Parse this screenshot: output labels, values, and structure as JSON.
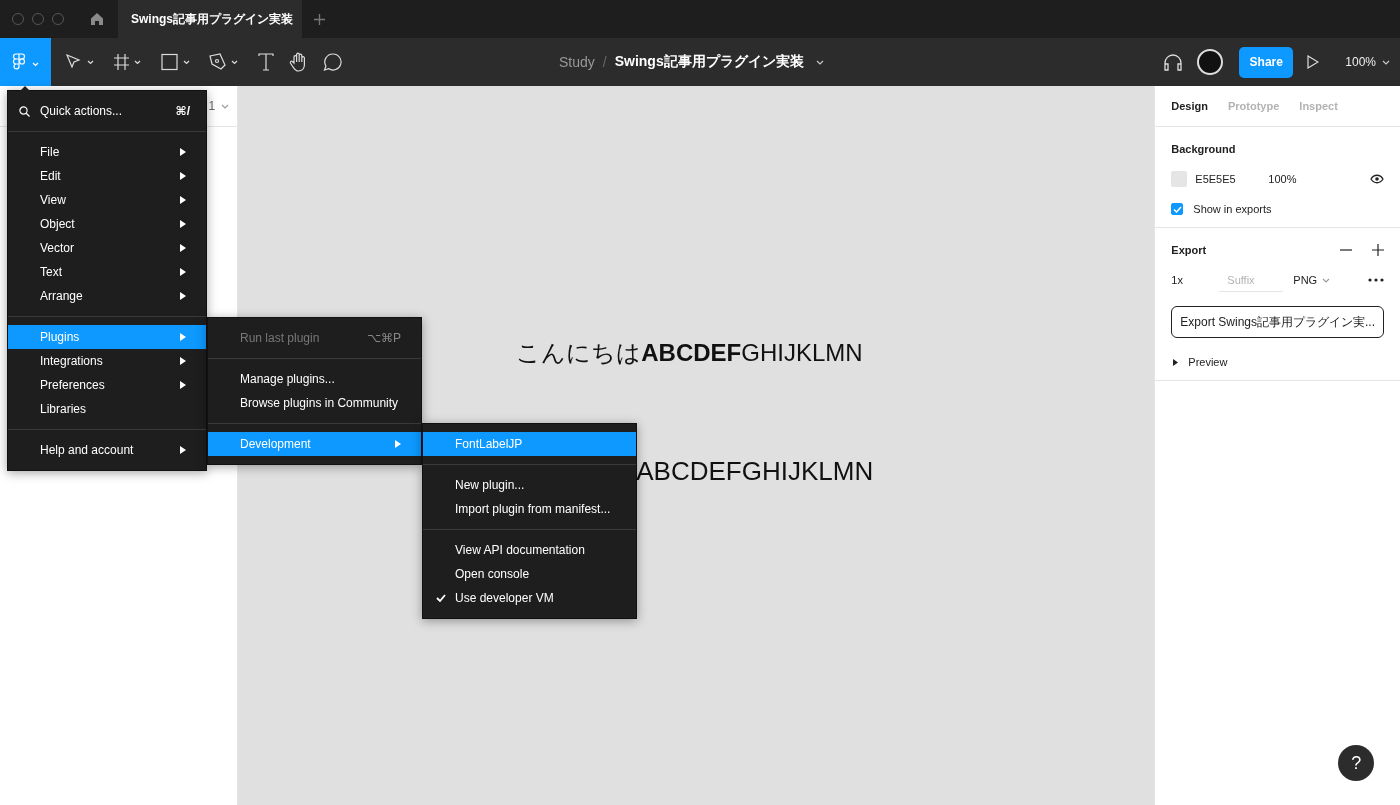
{
  "tab_bar": {
    "tabs": [
      {
        "title": "Swings記事用プラグイン実装",
        "selected": true
      }
    ]
  },
  "toolbar": {
    "breadcrumb": {
      "project": "Study",
      "separator": "/",
      "file": "Swings記事用プラグイン実装"
    },
    "share": "Share",
    "zoom": "100%"
  },
  "left_panel": {
    "page_selector": "1"
  },
  "canvas": {
    "texts": [
      "こんにちは**ABCDEF**GHIJKLMN",
      "ABCDEFGHIJKLMN"
    ]
  },
  "main_menu": {
    "search": {
      "label": "Quick actions...",
      "shortcut": "⌘/"
    },
    "items": [
      {
        "kind": "item",
        "label": "File",
        "submenu": true,
        "selected": false
      },
      {
        "kind": "item",
        "label": "Edit",
        "submenu": true,
        "selected": false
      },
      {
        "kind": "item",
        "label": "View",
        "submenu": true,
        "selected": false
      },
      {
        "kind": "item",
        "label": "Object",
        "submenu": true,
        "selected": false
      },
      {
        "kind": "item",
        "label": "Vector",
        "submenu": true,
        "selected": false
      },
      {
        "kind": "item",
        "label": "Text",
        "submenu": true,
        "selected": false
      },
      {
        "kind": "item",
        "label": "Arrange",
        "submenu": true,
        "selected": false
      },
      {
        "kind": "separator"
      },
      {
        "kind": "item",
        "label": "Plugins",
        "submenu": true,
        "selected": true
      },
      {
        "kind": "item",
        "label": "Integrations",
        "submenu": true,
        "selected": false
      },
      {
        "kind": "item",
        "label": "Preferences",
        "submenu": true,
        "selected": false
      },
      {
        "kind": "item",
        "label": "Libraries",
        "submenu": false,
        "selected": false
      },
      {
        "kind": "separator"
      },
      {
        "kind": "item",
        "label": "Help and account",
        "submenu": true,
        "selected": false
      }
    ]
  },
  "plugins_menu": {
    "items": [
      {
        "kind": "item",
        "label": "Run last plugin",
        "shortcut": "⌥⌘P",
        "disabled": true,
        "submenu": false,
        "selected": false
      },
      {
        "kind": "separator"
      },
      {
        "kind": "item",
        "label": "Manage plugins...",
        "disabled": false,
        "submenu": false,
        "selected": false
      },
      {
        "kind": "item",
        "label": "Browse plugins in Community",
        "disabled": false,
        "submenu": false,
        "selected": false
      },
      {
        "kind": "separator"
      },
      {
        "kind": "item",
        "label": "Development",
        "disabled": false,
        "submenu": true,
        "selected": true
      }
    ]
  },
  "development_menu": {
    "items": [
      {
        "kind": "item",
        "label": "FontLabelJP",
        "checked": false,
        "selected": true
      },
      {
        "kind": "separator"
      },
      {
        "kind": "item",
        "label": "New plugin...",
        "checked": false,
        "selected": false
      },
      {
        "kind": "item",
        "label": "Import plugin from manifest...",
        "checked": false,
        "selected": false
      },
      {
        "kind": "separator"
      },
      {
        "kind": "item",
        "label": "View API documentation",
        "checked": false,
        "selected": false
      },
      {
        "kind": "item",
        "label": "Open console",
        "checked": false,
        "selected": false
      },
      {
        "kind": "item",
        "label": "Use developer VM",
        "checked": true,
        "selected": false
      }
    ]
  },
  "right_panel": {
    "tabs": [
      {
        "label": "Design",
        "selected": true
      },
      {
        "label": "Prototype",
        "selected": false
      },
      {
        "label": "Inspect",
        "selected": false
      }
    ],
    "background": {
      "heading": "Background",
      "hex": "E5E5E5",
      "opacity": "100%",
      "show_in_exports": {
        "label": "Show in exports",
        "checked": true
      }
    },
    "export": {
      "heading": "Export",
      "scale": "1x",
      "suffix_placeholder": "Suffix",
      "format": "PNG",
      "button": "Export Swings記事用プラグイン実...",
      "preview": "Preview"
    }
  },
  "help": "?"
}
